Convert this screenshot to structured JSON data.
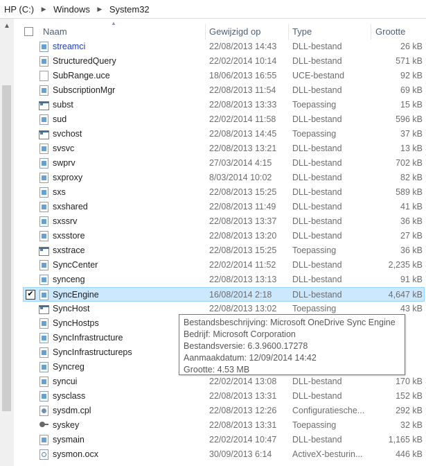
{
  "breadcrumb": [
    "HP (C:)",
    "Windows",
    "System32"
  ],
  "columns": {
    "name": "Naam",
    "date": "Gewijzigd op",
    "type": "Type",
    "size": "Grootte"
  },
  "files": [
    {
      "name": "streamci",
      "date": "22/08/2013 14:43",
      "type": "DLL-bestand",
      "size": "26 kB",
      "icon": "dll",
      "link": true
    },
    {
      "name": "StructuredQuery",
      "date": "22/02/2014 10:14",
      "type": "DLL-bestand",
      "size": "571 kB",
      "icon": "dll"
    },
    {
      "name": "SubRange.uce",
      "date": "18/06/2013 16:55",
      "type": "UCE-bestand",
      "size": "92 kB",
      "icon": "uce"
    },
    {
      "name": "SubscriptionMgr",
      "date": "22/08/2013 11:54",
      "type": "DLL-bestand",
      "size": "69 kB",
      "icon": "dll"
    },
    {
      "name": "subst",
      "date": "22/08/2013 13:33",
      "type": "Toepassing",
      "size": "15 kB",
      "icon": "exe"
    },
    {
      "name": "sud",
      "date": "22/02/2014 11:58",
      "type": "DLL-bestand",
      "size": "596 kB",
      "icon": "dll"
    },
    {
      "name": "svchost",
      "date": "22/08/2013 14:45",
      "type": "Toepassing",
      "size": "37 kB",
      "icon": "exe"
    },
    {
      "name": "svsvc",
      "date": "22/08/2013 13:21",
      "type": "DLL-bestand",
      "size": "13 kB",
      "icon": "dll"
    },
    {
      "name": "swprv",
      "date": "27/03/2014 4:15",
      "type": "DLL-bestand",
      "size": "702 kB",
      "icon": "dll"
    },
    {
      "name": "sxproxy",
      "date": "8/03/2014 10:02",
      "type": "DLL-bestand",
      "size": "82 kB",
      "icon": "dll"
    },
    {
      "name": "sxs",
      "date": "22/08/2013 15:25",
      "type": "DLL-bestand",
      "size": "589 kB",
      "icon": "dll"
    },
    {
      "name": "sxshared",
      "date": "22/08/2013 11:49",
      "type": "DLL-bestand",
      "size": "41 kB",
      "icon": "dll"
    },
    {
      "name": "sxssrv",
      "date": "22/08/2013 13:37",
      "type": "DLL-bestand",
      "size": "36 kB",
      "icon": "dll"
    },
    {
      "name": "sxsstore",
      "date": "22/08/2013 13:20",
      "type": "DLL-bestand",
      "size": "27 kB",
      "icon": "dll"
    },
    {
      "name": "sxstrace",
      "date": "22/08/2013 15:25",
      "type": "Toepassing",
      "size": "36 kB",
      "icon": "exe"
    },
    {
      "name": "SyncCenter",
      "date": "22/02/2014 11:52",
      "type": "DLL-bestand",
      "size": "2,235 kB",
      "icon": "dll"
    },
    {
      "name": "synceng",
      "date": "22/08/2013 13:13",
      "type": "DLL-bestand",
      "size": "91 kB",
      "icon": "dll"
    },
    {
      "name": "SyncEngine",
      "date": "16/08/2014 2:18",
      "type": "DLL-bestand",
      "size": "4,647 kB",
      "icon": "dll",
      "selected": true
    },
    {
      "name": "SyncHost",
      "date": "22/08/2013 13:02",
      "type": "Toepassing",
      "size": "43 kB",
      "icon": "exe"
    },
    {
      "name": "SyncHostps",
      "date": "",
      "type": "",
      "size": "",
      "icon": "dll"
    },
    {
      "name": "SyncInfrastructure",
      "date": "",
      "type": "",
      "size": "",
      "icon": "dll"
    },
    {
      "name": "SyncInfrastructureps",
      "date": "",
      "type": "",
      "size": "",
      "icon": "dll"
    },
    {
      "name": "Syncreg",
      "date": "",
      "type": "",
      "size": "",
      "icon": "dll"
    },
    {
      "name": "syncui",
      "date": "22/02/2014 13:08",
      "type": "DLL-bestand",
      "size": "170 kB",
      "icon": "dll"
    },
    {
      "name": "sysclass",
      "date": "22/08/2013 13:31",
      "type": "DLL-bestand",
      "size": "152 kB",
      "icon": "dll"
    },
    {
      "name": "sysdm.cpl",
      "date": "22/08/2013 12:26",
      "type": "Configuratiesche...",
      "size": "292 kB",
      "icon": "cpl"
    },
    {
      "name": "syskey",
      "date": "22/08/2013 13:31",
      "type": "Toepassing",
      "size": "32 kB",
      "icon": "key"
    },
    {
      "name": "sysmain",
      "date": "22/02/2014 10:47",
      "type": "DLL-bestand",
      "size": "1,165 kB",
      "icon": "dll"
    },
    {
      "name": "sysmon.ocx",
      "date": "30/09/2013 6:14",
      "type": "ActiveX-besturin...",
      "size": "446 kB",
      "icon": "ocx"
    }
  ],
  "tooltip": [
    "Bestandsbeschrijving: Microsoft OneDrive Sync Engine",
    "Bedrijf: Microsoft Corporation",
    "Bestandsversie: 6.3.9600.17278",
    "Aanmaakdatum: 12/09/2014 14:42",
    "Grootte: 4.53 MB"
  ]
}
